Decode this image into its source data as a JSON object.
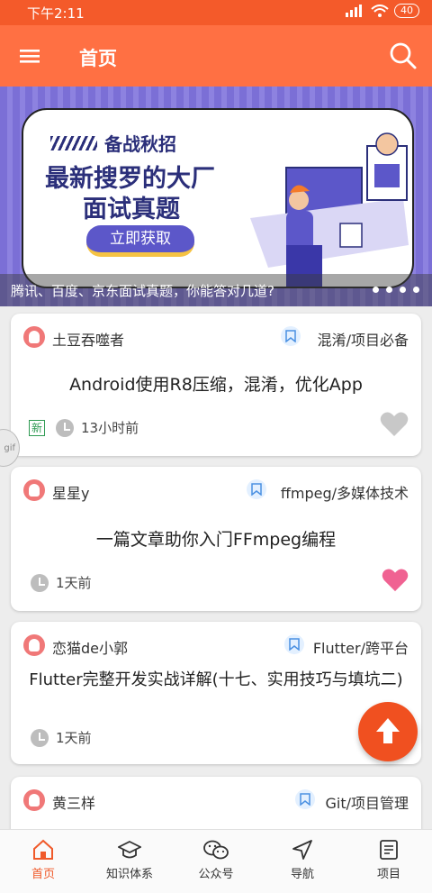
{
  "status_bar": {
    "time": "下午2:11",
    "battery": "40"
  },
  "toolbar": {
    "title": "首页"
  },
  "banner": {
    "subtitle": "备战秋招",
    "headline_1": "最新搜罗的大厂",
    "headline_2": "面试真题",
    "cta": "立即获取",
    "caption": "腾讯、百度、京东面试真题，你能答对几道?",
    "dot_count": 4
  },
  "articles": [
    {
      "author": "土豆吞噬者",
      "category": "混淆/项目必备",
      "title": "Android使用R8压缩，混淆，优化App",
      "is_new": true,
      "new_badge": "新",
      "time": "13小时前",
      "liked": false
    },
    {
      "author": "星星y",
      "category": "ffmpeg/多媒体技术",
      "title": "一篇文章助你入门FFmpeg编程",
      "is_new": false,
      "time": "1天前",
      "liked": true
    },
    {
      "author": "恋猫de小郭",
      "category": "Flutter/跨平台",
      "title": "Flutter完整开发实战详解(十七、实用技巧与填坑二)",
      "is_new": false,
      "time": "1天前",
      "liked": false
    },
    {
      "author": "黄三样",
      "category": "Git/项目管理"
    }
  ],
  "gif_label": "gif",
  "colors": {
    "primary": "#ff7043",
    "status_bar": "#f45a2a",
    "like": "#f06292",
    "fab": "#f05020"
  },
  "bottom_nav": [
    {
      "label": "首页",
      "icon": "home-icon",
      "active": true
    },
    {
      "label": "知识体系",
      "icon": "graduation-cap-icon",
      "active": false
    },
    {
      "label": "公众号",
      "icon": "wechat-icon",
      "active": false
    },
    {
      "label": "导航",
      "icon": "navigation-icon",
      "active": false
    },
    {
      "label": "项目",
      "icon": "project-icon",
      "active": false
    }
  ]
}
